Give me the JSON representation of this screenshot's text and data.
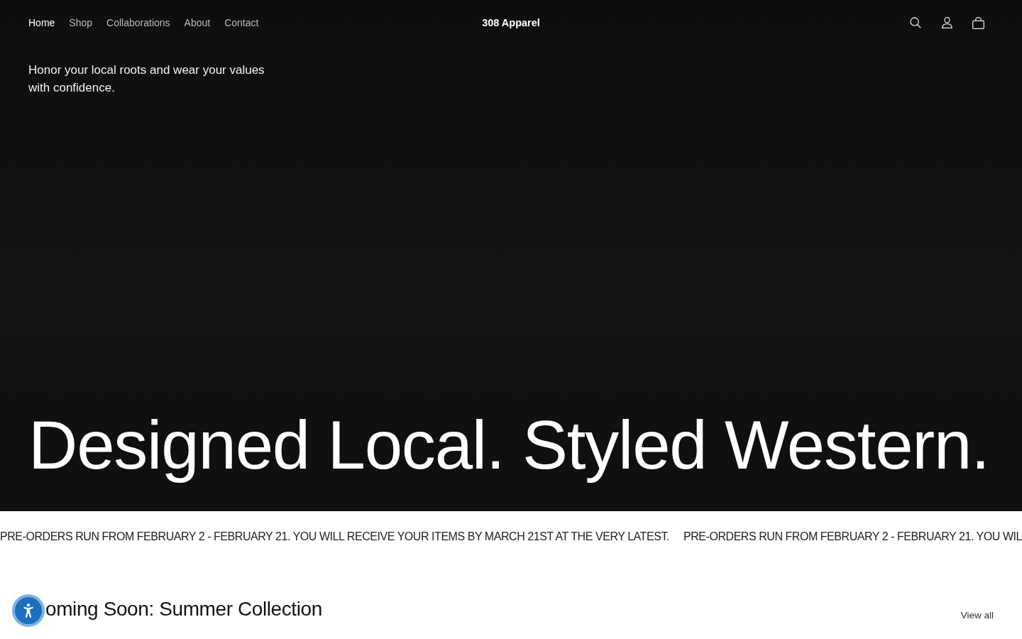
{
  "header": {
    "nav": [
      {
        "label": "Home",
        "selected": true
      },
      {
        "label": "Shop",
        "selected": false
      },
      {
        "label": "Collaborations",
        "selected": false
      },
      {
        "label": "About",
        "selected": false
      },
      {
        "label": "Contact",
        "selected": false
      }
    ],
    "logo": "308 Apparel"
  },
  "hero": {
    "tagline": "Honor your local roots and wear your values with confidence.",
    "headline": "Designed Local. Styled Western."
  },
  "announcement": {
    "items": [
      "PRE-ORDERS RUN FROM FEBRUARY 2 - FEBRUARY 21. YOU WILL RECEIVE YOUR ITEMS BY MARCH 21ST AT THE VERY LATEST.",
      "PRE-ORDERS RUN FROM FEBRUARY 2 - FEBRUARY 21. YOU WIL"
    ]
  },
  "collection": {
    "heading": "oming Soon: Summer Collection",
    "link": "View all"
  }
}
